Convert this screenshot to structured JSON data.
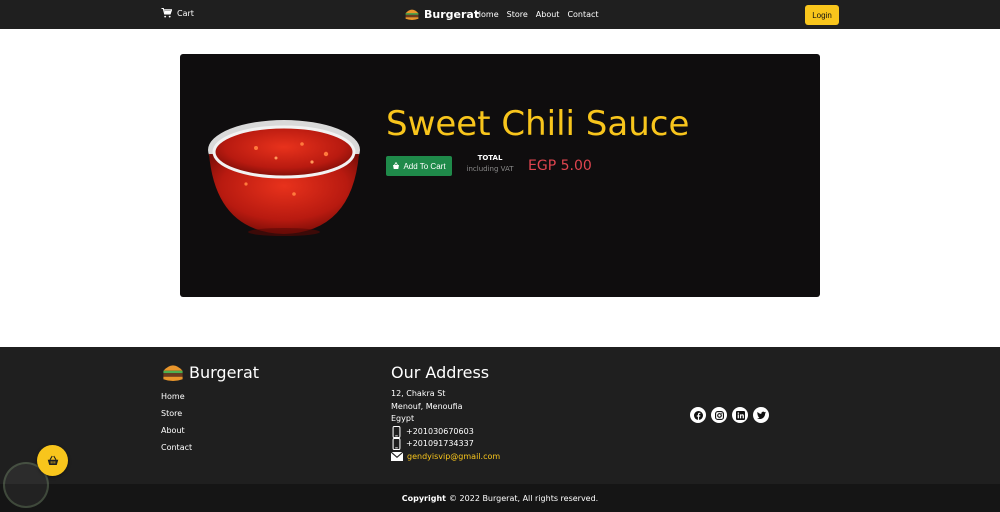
{
  "navbar": {
    "cart_label": "Cart",
    "brand": "Burgerat",
    "links": [
      "Home",
      "Store",
      "About",
      "Contact"
    ],
    "login_label": "Login"
  },
  "product": {
    "title": "Sweet Chili Sauce",
    "add_to_cart_label": "Add To Cart",
    "total_label": "TOTAL",
    "total_sub": "including VAT",
    "price": "EGP 5.00"
  },
  "footer": {
    "brand": "Burgerat",
    "links": [
      "Home",
      "Store",
      "About",
      "Contact"
    ],
    "address_title": "Our Address",
    "address_lines": [
      "12, Chakra St",
      "Menouf, Menoufia",
      "Egypt"
    ],
    "phones": [
      "+201030670603",
      "+201091734337"
    ],
    "email": "gendyisvip@gmail.com",
    "social_icons": [
      "facebook-icon",
      "instagram-icon",
      "linkedin-icon",
      "twitter-icon"
    ]
  },
  "copyright": {
    "label": "Copyright",
    "text": "© 2022 Burgerat, All rights reserved."
  },
  "colors": {
    "accent": "#f8c51c",
    "dark": "#1f1f1f",
    "price": "#e0454f",
    "add_button": "#1f8a4a"
  }
}
